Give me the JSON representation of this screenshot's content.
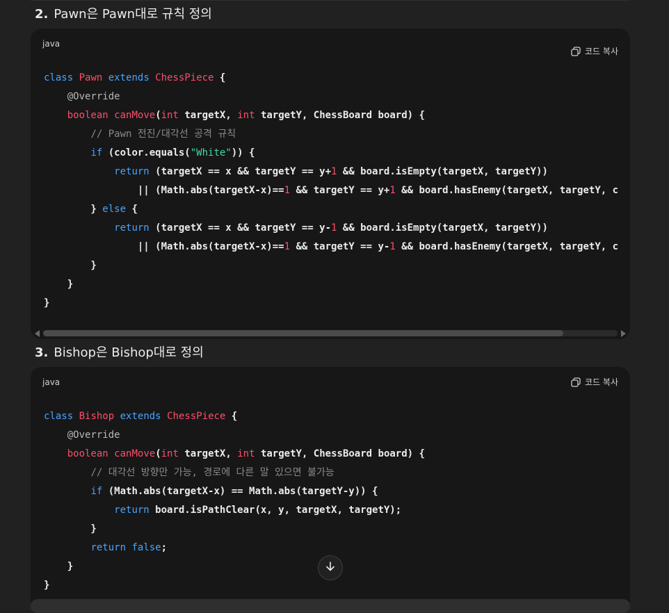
{
  "sections": [
    {
      "number": "2.",
      "title": "Pawn은 Pawn대로 규칙 정의",
      "language": "java",
      "copy_label": "코드 복사"
    },
    {
      "number": "3.",
      "title": "Bishop은 Bishop대로 정의",
      "language": "java",
      "copy_label": "코드 복사"
    }
  ],
  "code": {
    "pawn": [
      "class Pawn extends ChessPiece {",
      "    @Override",
      "    boolean canMove(int targetX, int targetY, ChessBoard board) {",
      "        // Pawn 전진/대각선 공격 규칙",
      "        if (color.equals(\"White\")) {",
      "            return (targetX == x && targetY == y+1 && board.isEmpty(targetX, targetY))",
      "                || (Math.abs(targetX-x)==1 && targetY == y+1 && board.hasEnemy(targetX, targetY, c",
      "        } else {",
      "            return (targetX == x && targetY == y-1 && board.isEmpty(targetX, targetY))",
      "                || (Math.abs(targetX-x)==1 && targetY == y-1 && board.hasEnemy(targetX, targetY, c",
      "        }",
      "    }",
      "}"
    ],
    "bishop": [
      "class Bishop extends ChessPiece {",
      "    @Override",
      "    boolean canMove(int targetX, int targetY, ChessBoard board) {",
      "        // 대각선 방향만 가능, 경로에 다른 말 있으면 불가능",
      "        if (Math.abs(targetX-x) == Math.abs(targetY-y)) {",
      "            return board.isPathClear(x, y, targetX, targetY);",
      "        }",
      "        return false;",
      "    }",
      "}"
    ]
  },
  "icons": {
    "copy": "copy-icon",
    "scroll_down": "arrow-down-icon"
  },
  "colors": {
    "background": "#212121",
    "code_background": "#171717",
    "keyword": "#4aa3ff",
    "type_name": "#ff4d6a",
    "string": "#3fd9a8",
    "comment": "#8a8a8a"
  }
}
